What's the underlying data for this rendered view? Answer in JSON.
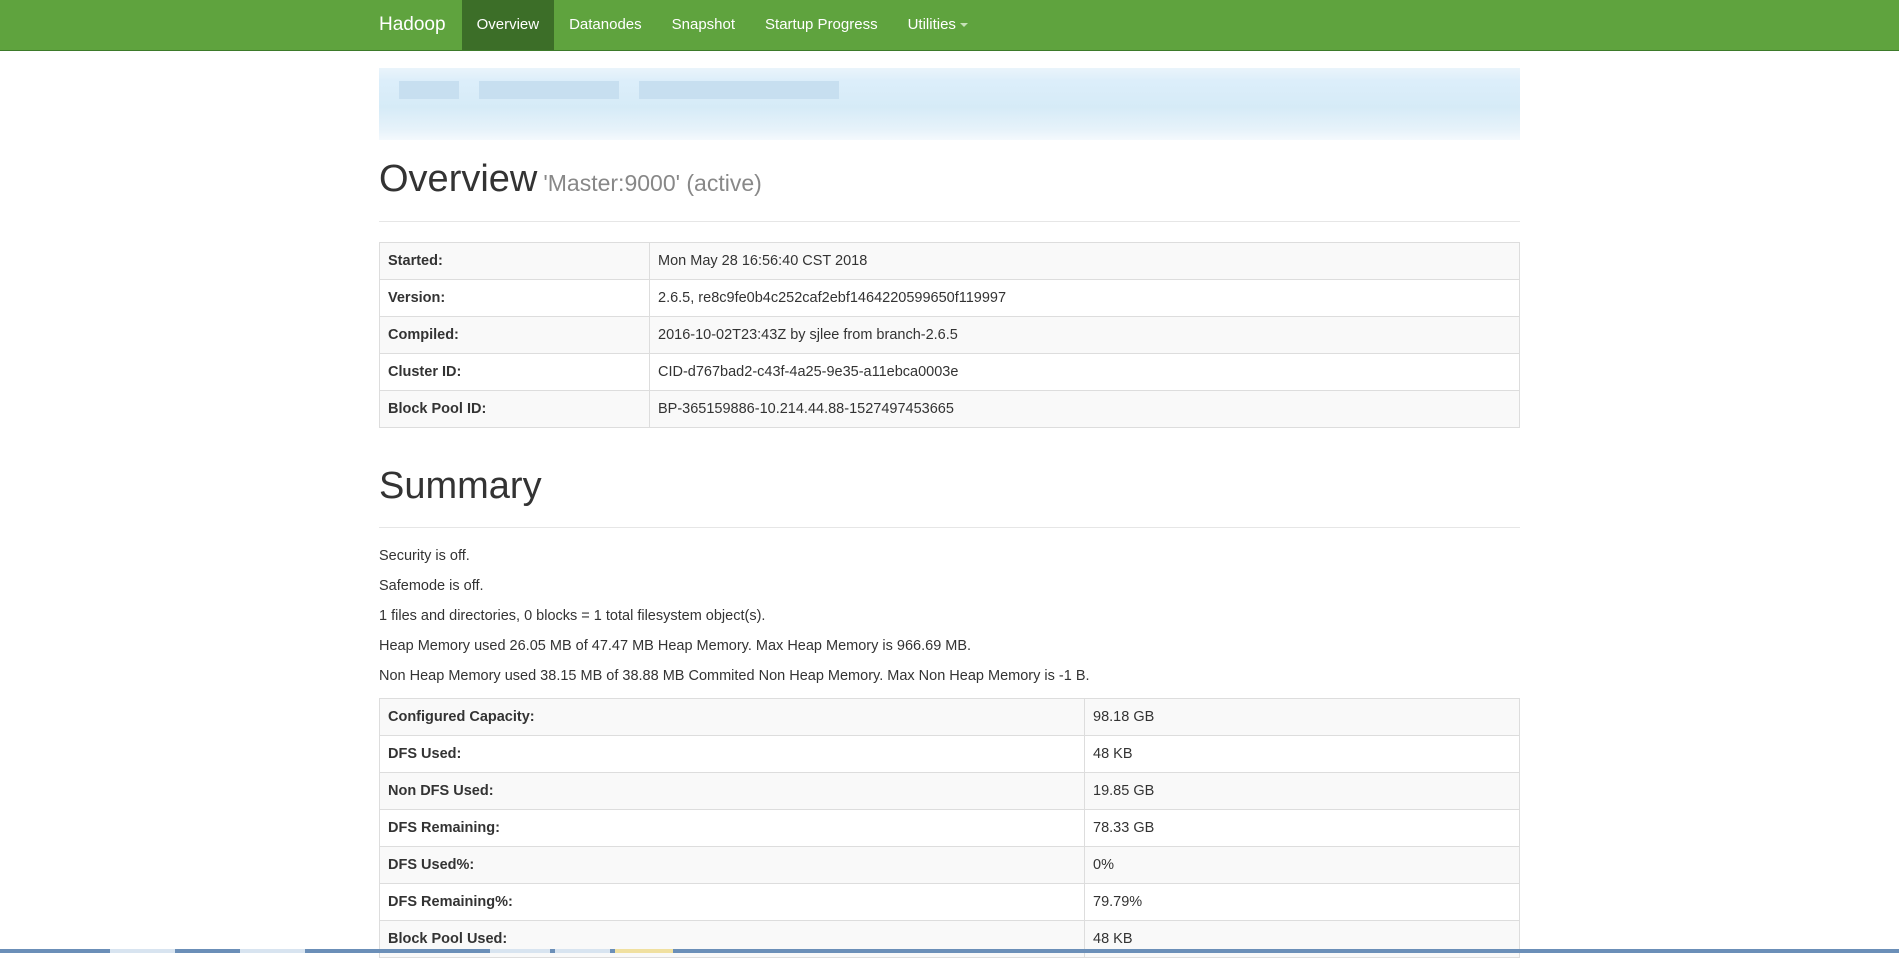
{
  "navbar": {
    "brand": "Hadoop",
    "items": [
      {
        "label": "Overview",
        "active": true
      },
      {
        "label": "Datanodes",
        "active": false
      },
      {
        "label": "Snapshot",
        "active": false
      },
      {
        "label": "Startup Progress",
        "active": false
      },
      {
        "label": "Utilities",
        "active": false
      }
    ],
    "color": "#5fa33e",
    "active_color": "#3c6e28"
  },
  "overview": {
    "title": "Overview",
    "subtitle": "'Master:9000' (active)",
    "rows": [
      {
        "label": "Started:",
        "value": "Mon May 28 16:56:40 CST 2018"
      },
      {
        "label": "Version:",
        "value": "2.6.5, re8c9fe0b4c252caf2ebf1464220599650f119997"
      },
      {
        "label": "Compiled:",
        "value": "2016-10-02T23:43Z by sjlee from branch-2.6.5"
      },
      {
        "label": "Cluster ID:",
        "value": "CID-d767bad2-c43f-4a25-9e35-a11ebca0003e"
      },
      {
        "label": "Block Pool ID:",
        "value": "BP-365159886-10.214.44.88-1527497453665"
      }
    ]
  },
  "summary": {
    "title": "Summary",
    "lines": [
      "Security is off.",
      "Safemode is off.",
      "1 files and directories, 0 blocks = 1 total filesystem object(s).",
      "Heap Memory used 26.05 MB of 47.47 MB Heap Memory. Max Heap Memory is 966.69 MB.",
      "Non Heap Memory used 38.15 MB of 38.88 MB Commited Non Heap Memory. Max Non Heap Memory is -1 B."
    ],
    "rows": [
      {
        "label": "Configured Capacity:",
        "value": "98.18 GB"
      },
      {
        "label": "DFS Used:",
        "value": "48 KB"
      },
      {
        "label": "Non DFS Used:",
        "value": "19.85 GB"
      },
      {
        "label": "DFS Remaining:",
        "value": "78.33 GB"
      },
      {
        "label": "DFS Used%:",
        "value": "0%"
      },
      {
        "label": "DFS Remaining%:",
        "value": "79.79%"
      },
      {
        "label": "Block Pool Used:",
        "value": "48 KB"
      }
    ]
  }
}
